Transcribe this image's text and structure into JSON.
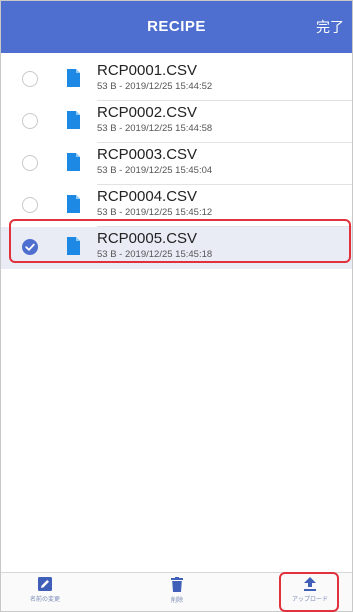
{
  "header": {
    "title": "RECIPE",
    "done_label": "完了"
  },
  "colors": {
    "accent": "#4f6fd0",
    "highlight": "#e0323c"
  },
  "files": [
    {
      "name": "RCP0001.CSV",
      "meta": "53 B - 2019/12/25 15:44:52",
      "selected": false
    },
    {
      "name": "RCP0002.CSV",
      "meta": "53 B - 2019/12/25 15:44:58",
      "selected": false
    },
    {
      "name": "RCP0003.CSV",
      "meta": "53 B - 2019/12/25 15:45:04",
      "selected": false
    },
    {
      "name": "RCP0004.CSV",
      "meta": "53 B - 2019/12/25 15:45:12",
      "selected": false
    },
    {
      "name": "RCP0005.CSV",
      "meta": "53 B - 2019/12/25 15:45:18",
      "selected": true
    }
  ],
  "toolbar": {
    "rename": {
      "label": "名前の変更",
      "icon": "rename-icon"
    },
    "delete": {
      "label": "削除",
      "icon": "trash-icon"
    },
    "upload": {
      "label": "アップロード",
      "icon": "upload-icon"
    }
  }
}
